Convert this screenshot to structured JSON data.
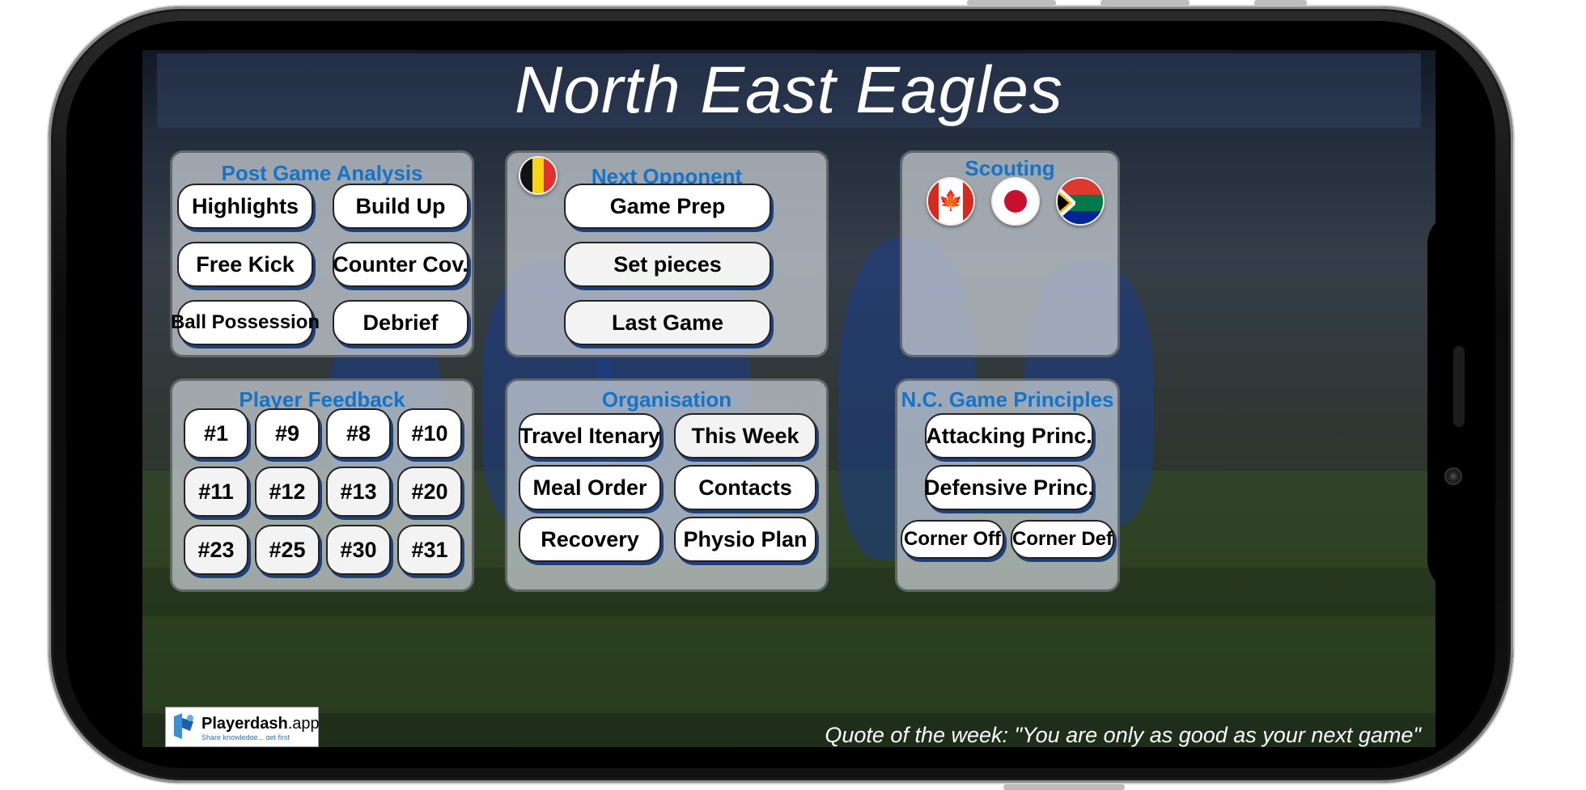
{
  "header": {
    "title": "North East Eagles"
  },
  "post_game": {
    "title": "Post Game Analysis",
    "buttons": [
      "Highlights",
      "Build Up",
      "Free Kick",
      "Counter Cov.",
      "Ball Possession",
      "Debrief"
    ]
  },
  "next_opponent": {
    "title": "Next Opponent",
    "flag": "belgium-flag-icon",
    "buttons": [
      "Game Prep",
      "Set pieces",
      "Last Game"
    ]
  },
  "scouting": {
    "title": "Scouting",
    "flags": [
      "canada-flag-icon",
      "japan-flag-icon",
      "south-africa-flag-icon"
    ]
  },
  "player_feedback": {
    "title": "Player Feedback",
    "buttons": [
      "#1",
      "#9",
      "#8",
      "#10",
      "#11",
      "#12",
      "#13",
      "#20",
      "#23",
      "#25",
      "#30",
      "#31"
    ]
  },
  "organisation": {
    "title": "Organisation",
    "buttons": [
      "Travel Itenary",
      "This Week",
      "Meal Order",
      "Contacts",
      "Recovery",
      "Physio Plan"
    ]
  },
  "principles": {
    "title": "N.C. Game Principles",
    "buttons": [
      "Attacking Princ.",
      "Defensive Princ.",
      "Corner Off",
      "Corner Def"
    ]
  },
  "footer": {
    "logo_brand": "Playerdash",
    "logo_suffix": ".app",
    "logo_tagline": "Share knowledge... get first",
    "quote": "Quote of the week: \"You are only as good as your next game\""
  },
  "colors": {
    "panel_title": "#1573c8",
    "button_shadow": "#1d3f7a"
  }
}
